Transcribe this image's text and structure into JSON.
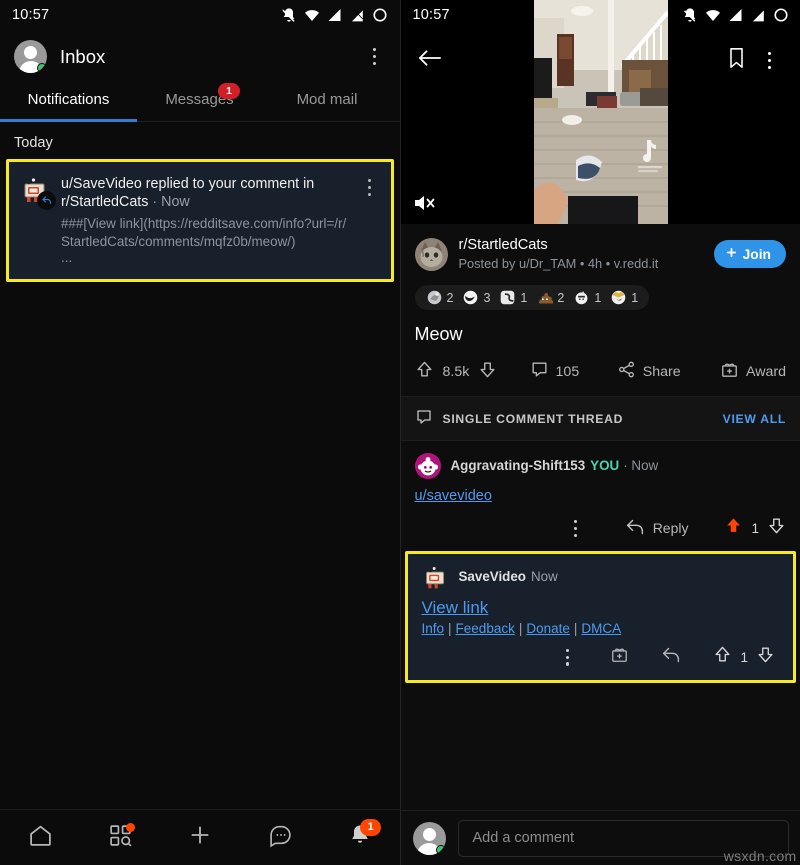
{
  "left": {
    "statusbar": {
      "time": "10:57",
      "icons": [
        "bell-off-icon",
        "wifi-icon",
        "signal-icon",
        "signal-off-icon",
        "battery-icon"
      ]
    },
    "header": {
      "title": "Inbox",
      "menu_icon": "kebab-menu-icon",
      "avatar_icon": "user-avatar"
    },
    "tabs": [
      {
        "label": "Notifications",
        "active": true,
        "badge": ""
      },
      {
        "label": "Messages",
        "active": false,
        "badge": "1"
      },
      {
        "label": "Mod mail",
        "active": false,
        "badge": ""
      }
    ],
    "section_header": "Today",
    "notification": {
      "title": "u/SaveVideo replied to your comment in r/StartledCats",
      "separator": "·",
      "time": "Now",
      "body": "###[View link](https://redditsave.com/info?url=/r/StartledCats/comments/mqfz0b/meow/)",
      "ellipsis": "...",
      "avatar_icon": "savevideo-bot-avatar",
      "badge_icon": "reply-badge-icon",
      "menu_icon": "kebab-menu-icon",
      "highlight_color": "#f7ea25"
    },
    "bottom_nav": [
      {
        "name": "home",
        "icon": "home-icon",
        "badge": ""
      },
      {
        "name": "discover",
        "icon": "grid-search-icon",
        "badge": "dot"
      },
      {
        "name": "create",
        "icon": "plus-icon",
        "badge": ""
      },
      {
        "name": "chat",
        "icon": "chat-bubble-icon",
        "badge": ""
      },
      {
        "name": "inbox",
        "icon": "bell-icon",
        "badge": "1"
      }
    ]
  },
  "right": {
    "statusbar": {
      "time": "10:57",
      "icons": [
        "bell-off-icon",
        "wifi-icon",
        "signal-icon",
        "signal-off-icon",
        "battery-icon"
      ]
    },
    "topbar": {
      "back_icon": "back-arrow-icon",
      "bookmark_icon": "bookmark-icon",
      "menu_icon": "kebab-menu-icon"
    },
    "video": {
      "mute_icon": "mute-icon",
      "watermark": "TikTok"
    },
    "post": {
      "subreddit": "r/StartledCats",
      "byline": "Posted by u/Dr_TAM • 4h • v.redd.it",
      "join_label": "Join",
      "join_icon": "plus-icon",
      "join_color": "#2f93e8",
      "awards": [
        {
          "icon": "silver-award-icon",
          "count": "2"
        },
        {
          "icon": "wholesome-award-icon",
          "count": "3"
        },
        {
          "icon": "snek-award-icon",
          "count": "1"
        },
        {
          "icon": "poop-award-icon",
          "count": "2"
        },
        {
          "icon": "table-flip-award-icon",
          "count": "1"
        },
        {
          "icon": "heart-eyes-award-icon",
          "count": "1"
        }
      ],
      "title": "Meow",
      "upvote_icon": "upvote-icon",
      "score": "8.5k",
      "downvote_icon": "downvote-icon",
      "comment_icon": "comment-icon",
      "comment_count": "105",
      "share_icon": "share-icon",
      "share_label": "Share",
      "award_icon": "award-gift-icon",
      "award_label": "Award"
    },
    "thread_bar": {
      "icon": "comment-icon",
      "label": "SINGLE COMMENT THREAD",
      "view_all": "VIEW ALL",
      "link_color": "#4d9bf0"
    },
    "comment": {
      "author": "Aggravating-Shift153",
      "you_badge": "YOU",
      "separator": "·",
      "time": "Now",
      "body": "u/savevideo",
      "avatar_icon": "snoo-avatar",
      "menu_icon": "kebab-menu-icon",
      "reply_icon": "reply-arrow-icon",
      "reply_label": "Reply",
      "upvote_icon": "upvote-icon",
      "score": "1",
      "downvote_icon": "downvote-icon"
    },
    "bot_reply": {
      "author": "SaveVideo",
      "time": "Now",
      "link_label": "View link",
      "footer_links": [
        "Info",
        "Feedback",
        "Donate",
        "DMCA"
      ],
      "separator": "|",
      "avatar_icon": "savevideo-bot-avatar",
      "menu_icon": "kebab-menu-icon",
      "gift_icon": "award-gift-icon",
      "reply_icon": "reply-arrow-icon",
      "upvote_icon": "upvote-icon",
      "score": "1",
      "downvote_icon": "downvote-icon",
      "highlight_color": "#f7ea25"
    },
    "composer": {
      "placeholder": "Add a comment",
      "avatar_icon": "user-avatar"
    },
    "watermark": "wsxdn.com"
  }
}
